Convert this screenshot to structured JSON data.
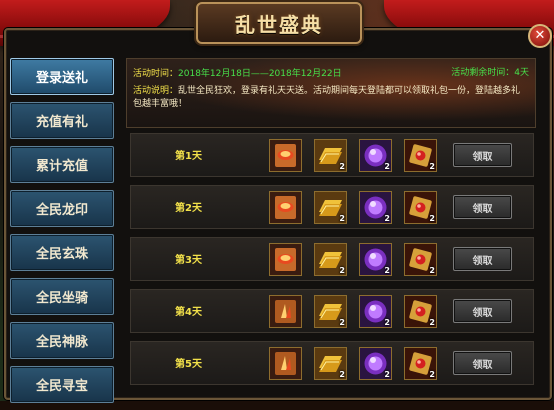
{
  "title": "乱世盛典",
  "sidebar": {
    "items": [
      {
        "label": "登录送礼",
        "active": true
      },
      {
        "label": "充值有礼",
        "active": false
      },
      {
        "label": "累计充值",
        "active": false
      },
      {
        "label": "全民龙印",
        "active": false
      },
      {
        "label": "全民玄珠",
        "active": false
      },
      {
        "label": "全民坐骑",
        "active": false
      },
      {
        "label": "全民神脉",
        "active": false
      },
      {
        "label": "全民寻宝",
        "active": false
      }
    ]
  },
  "info": {
    "time_label": "活动时间：",
    "time_range": "2018年12月18日——2018年12月22日",
    "remaining": "活动剩余时间：4天",
    "desc_label": "活动说明：",
    "desc_text": "乱世全民狂欢，登录有礼天天送。活动期间每天登陆都可以领取礼包一份，登陆越多礼包越丰富哦！"
  },
  "days": [
    {
      "label": "第1天",
      "button": "领取",
      "items": [
        {
          "icon": "scroll-item-icon",
          "qty": ""
        },
        {
          "icon": "gold-ingot-icon",
          "qty": "2"
        },
        {
          "icon": "purple-orb-icon",
          "qty": "2"
        },
        {
          "icon": "red-gem-box-icon",
          "qty": "2"
        }
      ]
    },
    {
      "label": "第2天",
      "button": "领取",
      "items": [
        {
          "icon": "scroll-item-icon",
          "qty": ""
        },
        {
          "icon": "gold-ingot-icon",
          "qty": "2"
        },
        {
          "icon": "purple-orb-icon",
          "qty": "2"
        },
        {
          "icon": "red-gem-box-icon",
          "qty": "2"
        }
      ]
    },
    {
      "label": "第3天",
      "button": "领取",
      "items": [
        {
          "icon": "scroll-item-icon",
          "qty": ""
        },
        {
          "icon": "gold-ingot-icon",
          "qty": "2"
        },
        {
          "icon": "purple-orb-icon",
          "qty": "2"
        },
        {
          "icon": "red-gem-box-icon",
          "qty": "2"
        }
      ]
    },
    {
      "label": "第4天",
      "button": "领取",
      "items": [
        {
          "icon": "feather-book-icon",
          "qty": ""
        },
        {
          "icon": "gold-ingot-icon",
          "qty": "2"
        },
        {
          "icon": "purple-orb-icon",
          "qty": "2"
        },
        {
          "icon": "red-gem-box-icon",
          "qty": "2"
        }
      ]
    },
    {
      "label": "第5天",
      "button": "领取",
      "items": [
        {
          "icon": "feather-book-icon",
          "qty": ""
        },
        {
          "icon": "gold-ingot-icon",
          "qty": "2"
        },
        {
          "icon": "purple-orb-icon",
          "qty": "2"
        },
        {
          "icon": "red-gem-box-icon",
          "qty": "2"
        }
      ]
    }
  ],
  "colors": {
    "accent_yellow": "#f2e14a",
    "date_green": "#48e04a",
    "nav_blue": "#2c5470",
    "ribbon_red": "#c21c1c"
  }
}
